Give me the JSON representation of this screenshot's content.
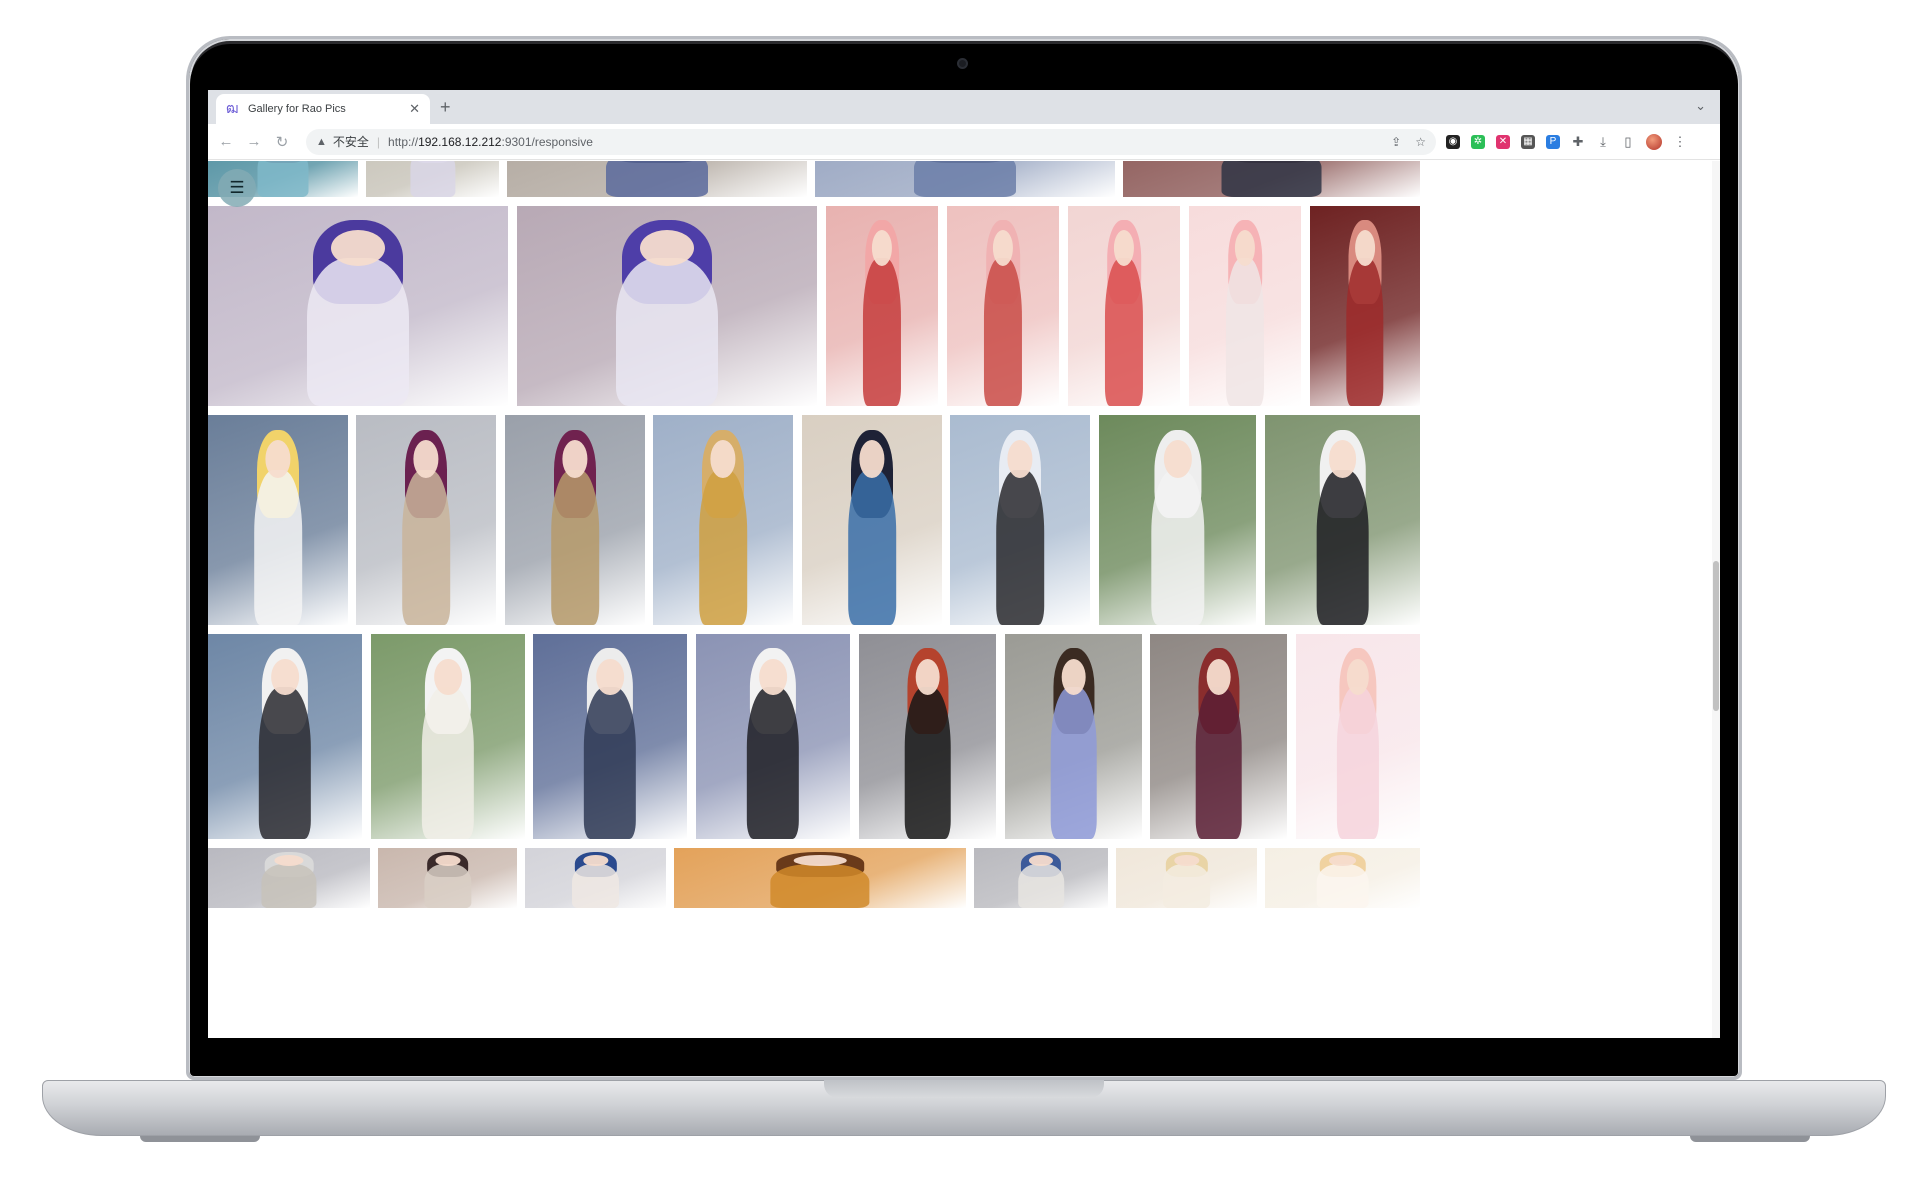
{
  "browser": {
    "tab_title": "Gallery for Rao Pics",
    "insecure_label": "不安全",
    "url_scheme": "http://",
    "url_host": "192.168.12.212",
    "url_rest": ":9301/responsive"
  },
  "icons": {
    "favicon": "gallery-favicon-icon",
    "filter": "sliders-icon",
    "back": "arrow-left-icon",
    "forward": "arrow-right-icon",
    "reload": "reload-icon",
    "warning": "warning-triangle-icon",
    "share": "share-icon",
    "bookmark": "star-icon"
  },
  "gallery": {
    "row_1": [
      {
        "hair": "#3a3a5a",
        "body": "#7fb8c9",
        "bg": "#4f8fa0"
      },
      {
        "hair": "#e6e4ee",
        "body": "#d9d6e6",
        "bg": "#c7c3b8"
      },
      {
        "hair": "#2e2e44",
        "body": "#5a6a9c",
        "bg": "#b2a9a0"
      },
      {
        "hair": "#2f3a5a",
        "body": "#6b7ea8",
        "bg": "#9aa7c2"
      },
      {
        "hair": "#5b2d2d",
        "body": "#2f3444",
        "bg": "#8e5c5a"
      }
    ],
    "row_2": [
      {
        "hair": "#4b3a9e",
        "body": "#ece9f3",
        "bg": "#c2b8c9"
      },
      {
        "hair": "#4e3ea8",
        "body": "#e9e6f2",
        "bg": "#b8a9b5"
      },
      {
        "hair": "#f2a7a7",
        "body": "#c53c3c",
        "bg": "#e8b2b0"
      },
      {
        "hair": "#f0b2b3",
        "body": "#c94b46",
        "bg": "#eec1bf"
      },
      {
        "hair": "#f4aeb3",
        "body": "#d94d4d",
        "bg": "#f2d5d3"
      },
      {
        "hair": "#f6b3b6",
        "body": "#f0e5e5",
        "bg": "#f7dcdc"
      },
      {
        "hair": "#d98a7f",
        "body": "#9e2a2a",
        "bg": "#6e2222"
      }
    ],
    "row_3": [
      {
        "hair": "#f1d36a",
        "body": "#f4f4f4",
        "bg": "#6a7e99"
      },
      {
        "hair": "#6b2150",
        "body": "#c9b49a",
        "bg": "#b9bcc3"
      },
      {
        "hair": "#70224f",
        "body": "#b69a6a",
        "bg": "#9aa0aa"
      },
      {
        "hair": "#d6ae6a",
        "body": "#d0a040",
        "bg": "#9fb0c8"
      },
      {
        "hair": "#1e2236",
        "body": "#3a6ea8",
        "bg": "#d9cfc2"
      },
      {
        "hair": "#e8ecf3",
        "body": "#2a2a2e",
        "bg": "#aabbd0"
      },
      {
        "hair": "#eeeeee",
        "body": "#f2f2f2",
        "bg": "#6d8a5c"
      },
      {
        "hair": "#f0f0f0",
        "body": "#1d1d22",
        "bg": "#7f9470"
      }
    ],
    "row_4": [
      {
        "hair": "#f1f1f1",
        "body": "#2a2a30",
        "bg": "#6e87a6"
      },
      {
        "hair": "#f3f3f3",
        "body": "#f1efe8",
        "bg": "#7c9a6a"
      },
      {
        "hair": "#ececec",
        "body": "#2f3a55",
        "bg": "#5f6f98"
      },
      {
        "hair": "#f2f2f2",
        "body": "#1f1f24",
        "bg": "#8b93b4"
      },
      {
        "hair": "#b5432d",
        "body": "#181818",
        "bg": "#8f8f95"
      },
      {
        "hair": "#3b2b22",
        "body": "#8e9ad8",
        "bg": "#9b9b95"
      },
      {
        "hair": "#8a2d2d",
        "body": "#5a1f35",
        "bg": "#8e8783"
      },
      {
        "hair": "#f6c7bf",
        "body": "#f6d3dc",
        "bg": "#f8e6ea"
      }
    ],
    "row_5": [
      {
        "hair": "#d9d9d9",
        "body": "#c7c2ba",
        "bg": "#b9b9c0"
      },
      {
        "hair": "#3a2a2a",
        "body": "#d9cfc6",
        "bg": "#c9b7ad"
      },
      {
        "hair": "#2a4a8e",
        "body": "#efe7e3",
        "bg": "#d3d3d9"
      },
      {
        "hair": "#6a3a1a",
        "body": "#d08a2a",
        "bg": "#e3a25a"
      },
      {
        "hair": "#3c5a9a",
        "body": "#e8e5e2",
        "bg": "#b9b9be"
      },
      {
        "hair": "#e9d4a6",
        "body": "#f3ece0",
        "bg": "#f0e7da"
      },
      {
        "hair": "#f0d2a0",
        "body": "#fbf6ee",
        "bg": "#f5efe4"
      },
      {
        "hair": "#4a3a2a",
        "body": "#9a8a72",
        "bg": "#7a6f60"
      }
    ]
  }
}
